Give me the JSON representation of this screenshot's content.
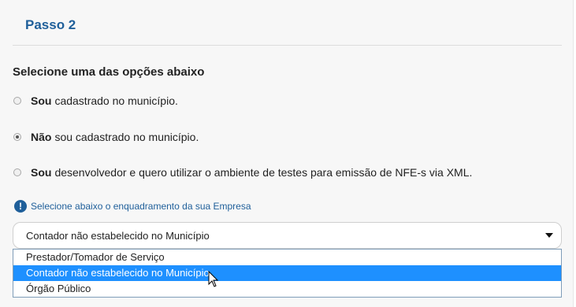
{
  "step": {
    "title": "Passo 2"
  },
  "question": "Selecione uma das opções abaixo",
  "options": [
    {
      "bold": "Sou",
      "text": "cadastrado no município.",
      "checked": false
    },
    {
      "bold": "Não",
      "text": "sou cadastrado no município.",
      "checked": true
    },
    {
      "bold": "Sou",
      "text": "desenvolvedor e quero utilizar o ambiente de testes para emissão de NFE-s via XML.",
      "checked": false
    }
  ],
  "info": {
    "icon": "exclamation-circle-icon",
    "text": "Selecione abaixo o enquadramento da sua Empresa"
  },
  "select": {
    "value": "Contador não estabelecido no Município",
    "options": [
      "Prestador/Tomador de Serviço",
      "Contador não estabelecido no Município",
      "Órgão Público"
    ],
    "hovered_option": "Contador não estabelecido no Município"
  },
  "colors": {
    "accent": "#1f5f9a",
    "highlight": "#1e90ff"
  }
}
